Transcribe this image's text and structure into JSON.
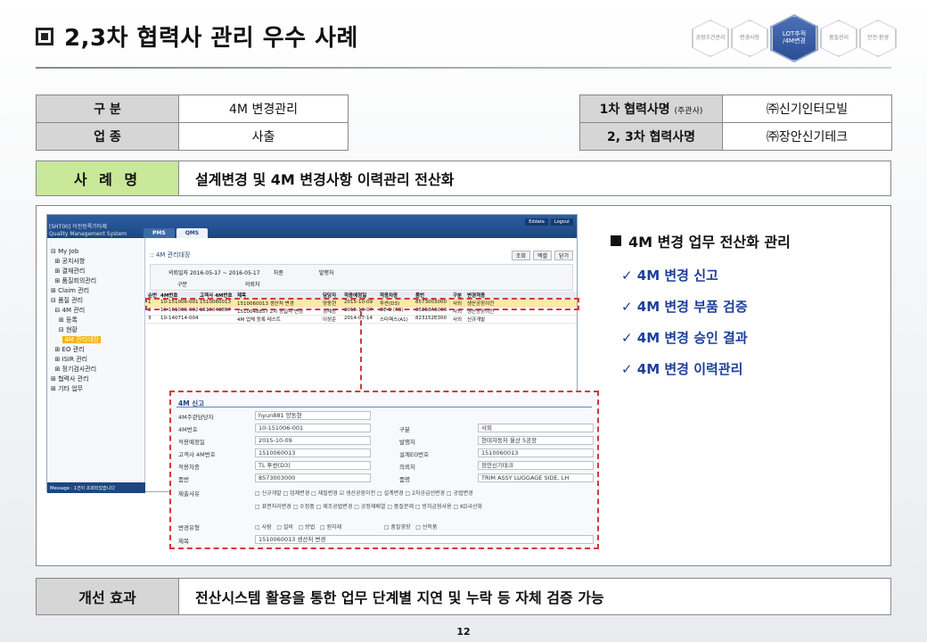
{
  "title": "2,3차 협력사 관리 우수 사례",
  "nav_hexes": [
    "공정조건관리",
    "변경사항",
    "LOT추적\n/4M변경",
    "품질관리",
    "안전·환경"
  ],
  "info": {
    "row1": {
      "k1": "구      분",
      "v1": "4M 변경관리",
      "k2": "1차 협력사명",
      "k2_small": "(주관사)",
      "v2": "㈜신기인터모빌"
    },
    "row2": {
      "k1": "업      종",
      "v1": "사출",
      "k2": "2, 3차 협력사명",
      "v2": "㈜장안신기테크"
    }
  },
  "case": {
    "label": "사 례 명",
    "value": "설계변경 및 4M 변경사항 이력관리 전산화"
  },
  "bullets": {
    "heading": "4M 변경 업무 전산화 관리",
    "items": [
      "✓ 4M 변경 신고",
      "✓ 4M 변경 부품 검증",
      "✓ 4M 변경 승인 결과",
      "✓ 4M 변경 이력관리"
    ]
  },
  "effect": {
    "label": "개선 효과",
    "value": "전산시스템 활용을 통한 업무 단계별 지연 및 누락 등 자체 검증 가능"
  },
  "page_number": "12",
  "app": {
    "brand1": "[SHT00] 이전등록기타제",
    "brand2": "Quality Management System",
    "tabs": [
      "PMS",
      "QMS"
    ],
    "top_buttons": [
      "Eddata",
      "Logout"
    ],
    "tree": [
      "⊟ My Job",
      "  ⊞ 공지사항",
      "  ⊞ 결재관리",
      "  ⊞ 품질회의관리",
      "⊞ Claim 관리",
      "⊟ 품질 관리",
      "  ⊟ 4M 관리",
      "    ⊞ 등록",
      "    ⊟ 현황",
      "      4M 관리대장",
      "  ⊞ EO 관리",
      "  ⊞ ISIR 관리",
      "  ⊞ 정기검사관리",
      "⊞ 협력사 관리",
      "⊞ 기타 업무"
    ],
    "tree_selected": "4M 관리대장",
    "message": "Message  : 1건이 조회되었습니다",
    "crumb": "4M 관리대장",
    "buttons": [
      "조회",
      "엑셀",
      "닫기"
    ],
    "filter1": "의뢰일자 2016-05-17 ~ 2016-05-17        차종                     발행처",
    "filter2": "구분                                  의뢰처",
    "grid_header": [
      "순번",
      "4M번호",
      "고객사 4M번호",
      "제목",
      "담당자",
      "적용예정일",
      "적용차종",
      "품번",
      "구분",
      "변경적용"
    ],
    "grid_rows": [
      [
        "1",
        "10-151006-001",
        "1510060013",
        "1510060013 생산처 변경",
        "양동현",
        "2015-10-09",
        "투싼(D3)",
        "8573003000",
        "사외",
        "생산공장이전"
      ],
      [
        "2",
        "10-151006-002",
        "1510048857",
        "1510048857 2차 공급사 변경",
        "정재능",
        "2015-10-07",
        "DE-B (6B)",
        "85858A5000",
        "사외",
        "생산공장이전"
      ],
      [
        "3",
        "10-140714-004",
        "",
        "4M 업체 등록 테스트",
        "이성준",
        "2014-07-14",
        "스타렉스(A1)",
        "823152E300",
        "사외",
        "신규개발"
      ]
    ]
  },
  "popup": {
    "title": "4M 신고",
    "fields": [
      {
        "label": "4M주관담당자",
        "value": "hyun881  양동현"
      },
      {
        "label": "4M번호",
        "value": "10-151006-001"
      },
      {
        "label": "적용예정일",
        "value": "2015-10-09"
      },
      {
        "label": "고객사 4M번호",
        "value": "1510060013"
      },
      {
        "label": "적용차종",
        "value": "TL    투싼(D3)"
      },
      {
        "label": "품번",
        "value": "8573003000"
      }
    ],
    "right_fields": [
      {
        "label": "구분",
        "value": "사외"
      },
      {
        "label": "발행처",
        "value": "현대자동차  울산 5공장"
      },
      {
        "label": "설계EO번호",
        "value": "1510060013"
      },
      {
        "label": "의뢰처",
        "value": "장안신기테크"
      },
      {
        "label": "품명",
        "value": "TRIM ASSY LUGGAGE SIDE, LH"
      }
    ],
    "reason_label": "제출사유",
    "reasons1": "□ 신규개발  □ 업체변경  □ 재질변경  ☑ 생산공장이전  □ 설계변경  □ 2차공급선변경  □ 공법변경",
    "reasons2": "□ 표면처리변경  □ 수정품  □ 제조공법변경  □ 공정재배열  □ 품질문제  □ 방치금형사용  □ KD국산화",
    "type_label": "변경유형",
    "types": "□ 사람   □ 설비   □ 방법   □ 원자재                         □ 품질영향   □ 선적품",
    "subject_label": "제목",
    "subject_value": "1510060013  생산처 변경"
  }
}
